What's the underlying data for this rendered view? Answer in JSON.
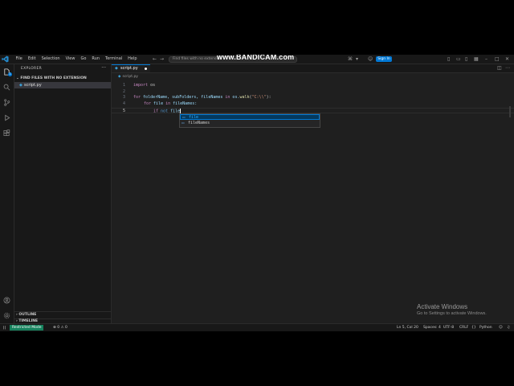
{
  "watermark": "www.BANDICAM.com",
  "titlebar": {
    "menu": [
      "File",
      "Edit",
      "Selection",
      "View",
      "Go",
      "Run",
      "Terminal",
      "Help"
    ],
    "search_text": "Find files with no extension",
    "signin_label": "Sign In"
  },
  "sidebar": {
    "title": "EXPLORER",
    "folder": "FIND FILES WITH NO EXTENSION",
    "file": "script.py",
    "outline": "OUTLINE",
    "timeline": "TIMELINE"
  },
  "editor": {
    "tab_label": "script.py",
    "breadcrumb": "script.py",
    "line_numbers": [
      "1",
      "2",
      "3",
      "4",
      "5"
    ],
    "lines": {
      "l1_kw": "import",
      "l1_rest": " os",
      "l3_kw": "for",
      "l3_vars": " folderName, subFolders, fileNames ",
      "l3_in": "in",
      "l3_mod": " os.",
      "l3_fn": "walk",
      "l3_open": "(",
      "l3_str": "\"C:\\\\\"",
      "l3_close": "):",
      "l4_kw": "for",
      "l4_var": " file ",
      "l4_in": "in",
      "l4_rest": " fileNames:",
      "l5_kw": "if",
      "l5_not": " not",
      "l5_typed": " file"
    },
    "suggestions": [
      "file",
      "fileNames"
    ]
  },
  "statusbar": {
    "restricted": "Restricted Mode",
    "problems": "⊗ 0 ⚠ 0",
    "position": "Ln 5, Col 20",
    "spaces": "Spaces: 4",
    "encoding": "UTF-8",
    "eol": "CRLF",
    "language": "Python"
  },
  "activation": {
    "title": "Activate Windows",
    "subtitle": "Go to Settings to activate Windows."
  }
}
